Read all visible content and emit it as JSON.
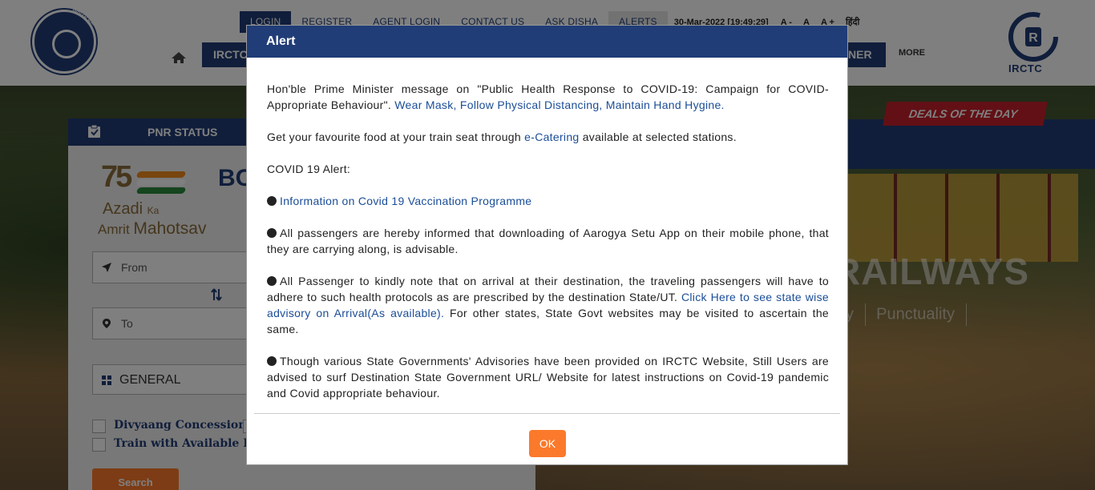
{
  "header": {
    "topnav": [
      "LOGIN",
      "REGISTER",
      "AGENT LOGIN",
      "CONTACT US",
      "ASK DISHA",
      "ALERTS"
    ],
    "datetime": "30-Mar-2022 [19:49:29]",
    "font_sizes": [
      "A -",
      "A",
      "A +"
    ],
    "hindi": "हिंदी",
    "mainnav_first": "IRCTC",
    "mainnav_partner": "NER",
    "more": "MORE",
    "ir_logo_text": "INDIAN RAILWAYS",
    "irctc_logo_text": "IRCTC"
  },
  "hero": {
    "deals": "DEALS OF THE DAY",
    "railways": "RAILWAYS",
    "tagline": [
      "ity",
      "Punctuality"
    ]
  },
  "booking": {
    "pnr_status": "PNR STATUS",
    "heading": "BO",
    "azadi": {
      "seventyfive": "75",
      "line1": "Azadi",
      "line1_small": "Ka",
      "line2": "Amrit",
      "line2_big": "Mahotsav"
    },
    "from_label": "From",
    "to_label": "To",
    "quota": "GENERAL",
    "checkbox_divyaang": "Divyaang Concession",
    "checkbox_berth": "Train with Available Berth",
    "search": "Search"
  },
  "modal": {
    "title": "Alert",
    "p1_text": "Hon'ble Prime Minister message on \"Public Health Response to COVID-19: Campaign for COVID-Appropriate Behaviour\". ",
    "p1_link": "Wear Mask, Follow Physical Distancing, Maintain Hand Hygine.",
    "p2_pre": "Get your favourite food at your train seat through ",
    "p2_link": "e-Catering",
    "p2_post": " available at selected stations.",
    "p3": "COVID 19 Alert:",
    "p4_link": "Information on Covid 19 Vaccination Programme",
    "p5": "All passengers are hereby informed that downloading of Aarogya Setu App on their mobile phone, that they are carrying along, is advisable.",
    "p6_pre": "All Passenger to kindly note that on arrival at their destination, the traveling passengers will have to adhere to such health protocols as are prescribed by the destination State/UT. ",
    "p6_link": "Click Here to see state wise advisory on Arrival(As available).",
    "p6_post": " For other states, State Govt websites may be visited to ascertain the same.",
    "p7": "Though various State Governments' Advisories have been provided on IRCTC Website, Still Users are advised to surf Destination State Government URL/ Website for latest instructions on Covid-19 pandemic and Covid appropriate behaviour.",
    "ok": "OK"
  },
  "colors": {
    "navy": "#213d77",
    "orange": "#fb792b",
    "link": "#1a4d98"
  },
  "icons": [
    "home-icon",
    "pnr-clipboard-icon",
    "location-arrow-icon",
    "map-pin-icon",
    "grid-icon",
    "swap-icon",
    "bullet-icon"
  ]
}
